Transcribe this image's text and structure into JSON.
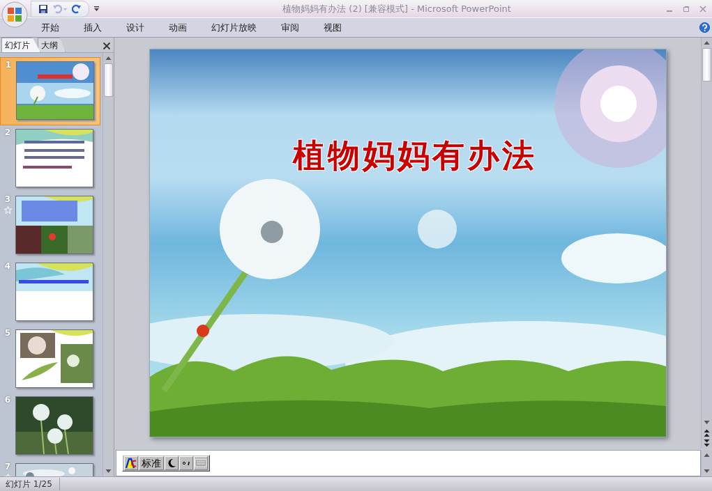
{
  "window": {
    "title": "植物妈妈有办法 (2) [兼容模式] - Microsoft PowerPoint"
  },
  "ribbon_tabs": [
    {
      "label": "开始",
      "selected": false
    },
    {
      "label": "插入",
      "selected": false
    },
    {
      "label": "设计",
      "selected": false
    },
    {
      "label": "动画",
      "selected": false
    },
    {
      "label": "幻灯片放映",
      "selected": false
    },
    {
      "label": "审阅",
      "selected": false
    },
    {
      "label": "视图",
      "selected": false
    }
  ],
  "panel_tabs": [
    {
      "label": "幻灯片",
      "selected": true
    },
    {
      "label": "大纲",
      "selected": false
    }
  ],
  "slides": [
    {
      "number": "1",
      "selected": true,
      "animated": false
    },
    {
      "number": "2",
      "selected": false,
      "animated": false
    },
    {
      "number": "3",
      "selected": false,
      "animated": true
    },
    {
      "number": "4",
      "selected": false,
      "animated": false
    },
    {
      "number": "5",
      "selected": false,
      "animated": false
    },
    {
      "number": "6",
      "selected": false,
      "animated": false
    },
    {
      "number": "7",
      "selected": false,
      "animated": true
    }
  ],
  "current_slide": {
    "title": "植物妈妈有办法"
  },
  "ime_bar": {
    "mode": "标准"
  },
  "status_bar": {
    "slide_position": "幻灯片 1/25"
  }
}
